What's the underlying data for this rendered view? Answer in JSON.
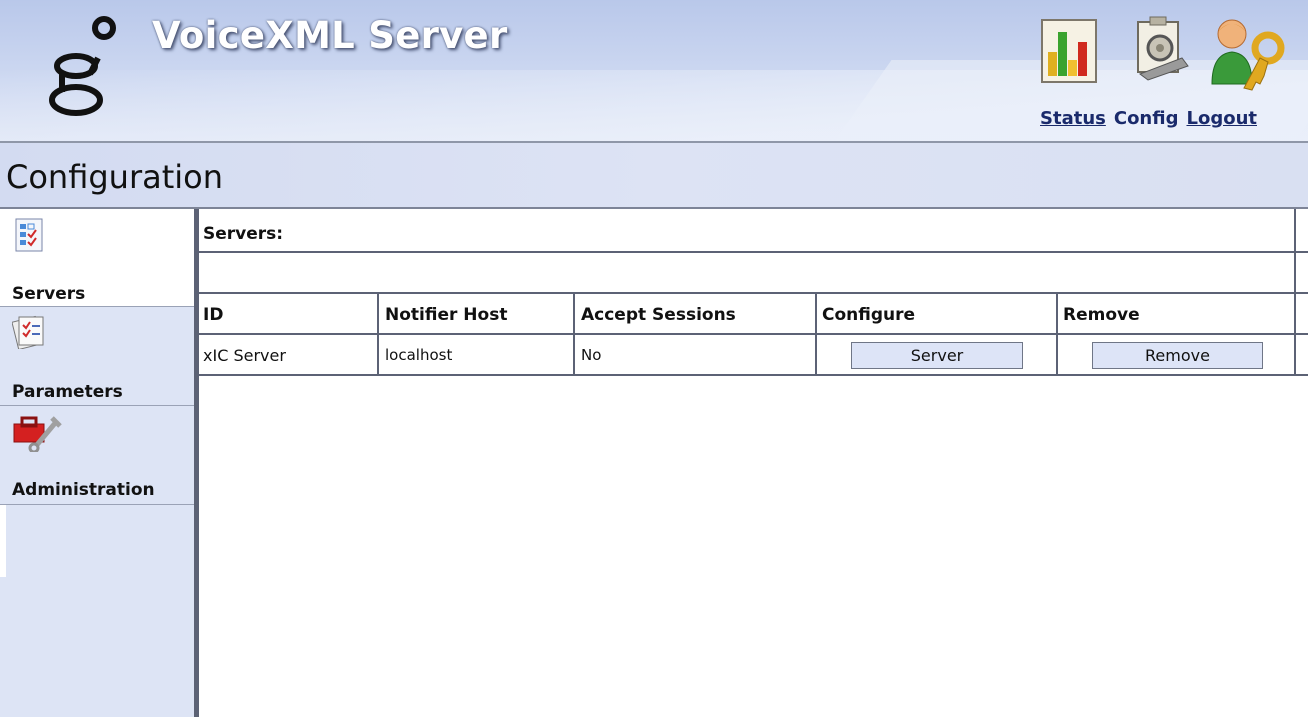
{
  "header": {
    "app_title": "VoiceXML Server",
    "links": [
      {
        "label": "Status",
        "underlined": true
      },
      {
        "label": "Config",
        "underlined": false
      },
      {
        "label": "Logout",
        "underlined": true
      }
    ]
  },
  "page": {
    "title": "Configuration"
  },
  "sidebar": {
    "items": [
      {
        "label": "Servers",
        "icon": "servers-checklist-icon",
        "selected": true
      },
      {
        "label": "Parameters",
        "icon": "parameters-clipboard-icon",
        "selected": false
      },
      {
        "label": "Administration",
        "icon": "toolbox-wrench-icon",
        "selected": false
      }
    ]
  },
  "servers": {
    "section_label": "Servers:",
    "columns": [
      "ID",
      "Notifier Host",
      "Accept Sessions",
      "Configure",
      "Remove"
    ],
    "rows": [
      {
        "id": "xIC Server",
        "notifier_host": "localhost",
        "accept_sessions": "No",
        "configure_button": "Server",
        "remove_button": "Remove"
      }
    ]
  },
  "colors": {
    "header_bg": "#cdd8f1",
    "nav_bg": "#dde4f5",
    "link_color": "#1a2a6b",
    "button_bg": "#dde4f7",
    "border": "#5c6275"
  }
}
